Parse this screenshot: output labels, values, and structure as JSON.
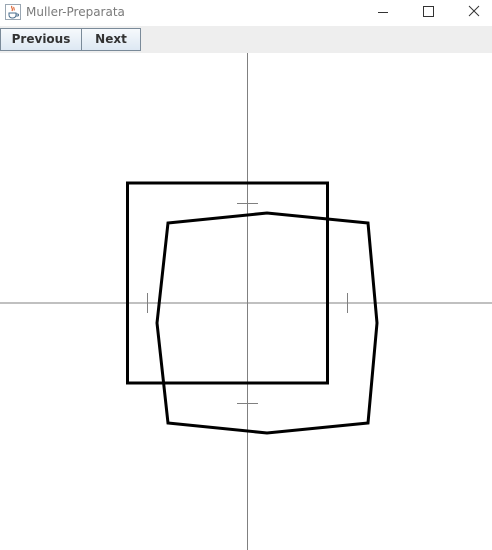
{
  "window": {
    "title": "Muller-Preparata",
    "app_icon": "java-cup-icon",
    "controls": [
      "minimize-icon",
      "maximize-icon",
      "close-icon"
    ]
  },
  "toolbar": {
    "previous_label": "Previous",
    "next_label": "Next"
  },
  "canvas": {
    "axes_color": "#808080",
    "shape_color": "#000000",
    "background": "#ffffff"
  }
}
